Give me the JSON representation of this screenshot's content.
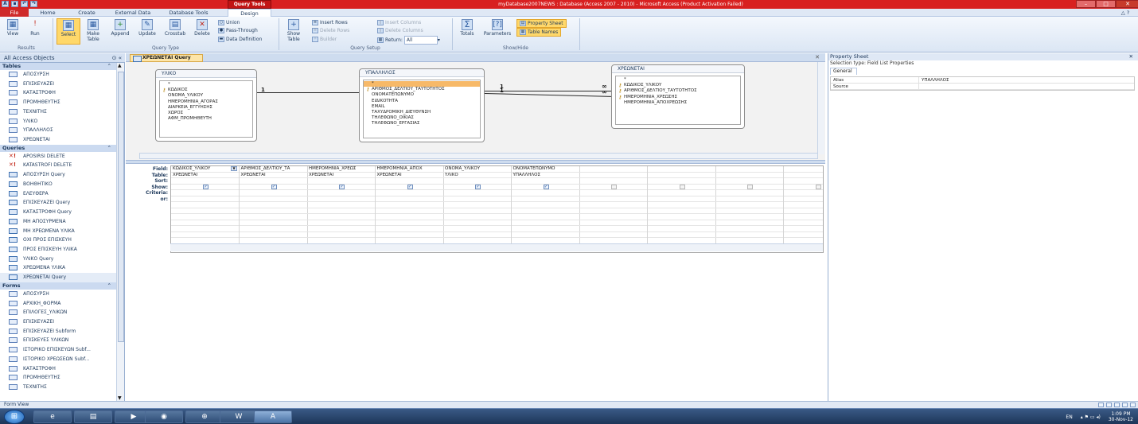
{
  "window": {
    "title": "myDatabase2007NEWS : Database (Access 2007 - 2010) - Microsoft Access (Product Activation Failed)",
    "context_tab": "Query Tools"
  },
  "ribbon_tabs": [
    "File",
    "Home",
    "Create",
    "External Data",
    "Database Tools",
    "Design"
  ],
  "ribbon": {
    "results": {
      "view": "View",
      "run": "Run",
      "group": "Results"
    },
    "query_type": {
      "select": "Select",
      "make_table": "Make Table",
      "append": "Append",
      "update": "Update",
      "crosstab": "Crosstab",
      "delete": "Delete",
      "union": "Union",
      "pass_through": "Pass-Through",
      "data_definition": "Data Definition",
      "group": "Query Type"
    },
    "query_setup": {
      "show_table": "Show Table",
      "insert_rows": "Insert Rows",
      "delete_rows": "Delete Rows",
      "builder": "Builder",
      "insert_columns": "Insert Columns",
      "delete_columns": "Delete Columns",
      "return_label": "Return:",
      "return_value": "All",
      "group": "Query Setup"
    },
    "show_hide": {
      "totals": "Totals",
      "parameters": "Parameters",
      "property_sheet": "Property Sheet",
      "table_names": "Table Names",
      "group": "Show/Hide"
    }
  },
  "nav": {
    "header": "All Access Objects",
    "sections": [
      {
        "title": "Tables",
        "type": "table",
        "items": [
          "ΑΠΟΣΥΡΣΗ",
          "ΕΠΙΣΚΕΥΑΖΕΙ",
          "ΚΑΤΑΣΤΡΟΦΗ",
          "ΠΡΟΜΗΘΕΥΤΗΣ",
          "ΤΕΧΝΙΤΗΣ",
          "ΥΛΙΚΟ",
          "ΥΠΑΛΛΗΛΟΣ",
          "ΧΡΕΩΝΕΤΑΙ"
        ]
      },
      {
        "title": "Queries",
        "type": "query",
        "items": [
          "APOSIRSI DELETE",
          "KATASTROFI DELETE",
          "ΑΠΟΣΥΡΣΗ Query",
          "ΒΟΗΘΗΤΙΚΟ",
          "ΕΛΕΥΘΕΡΑ",
          "ΕΠΙΣΚΕΥΑΖΕΙ Query",
          "ΚΑΤΑΣΤΡΟΦΗ Query",
          "ΜΗ ΑΠΟΣΥΡΜΕΝΑ",
          "ΜΗ ΧΡΕΩΜΕΝΑ ΥΛΙΚΑ",
          "ΟΧΙ ΠΡΟΣ ΕΠΙΣΚΕΥΗ",
          "ΠΡΟΣ ΕΠΙΣΚΕΥΗ ΥΛΙΚΑ",
          "ΥΛΙΚΟ Query",
          "ΧΡΕΩΜΕΝΑ ΥΛΙΚΑ",
          "ΧΡΕΩΝΕΤΑΙ Query"
        ]
      },
      {
        "title": "Forms",
        "type": "form",
        "items": [
          "ΑΠΟΣΥΡΣΗ",
          "ΑΡΧΙΚΗ_ΦΟΡΜΑ",
          "ΕΠΙΛΟΓΕΣ_ΥΛΙΚΩΝ",
          "ΕΠΙΣΚΕΥΑΖΕΙ",
          "ΕΠΙΣΚΕΥΑΖΕΙ Subform",
          "ΕΠΙΣΚΕΥΕΣ ΥΛΙΚΩΝ",
          "ΙΣΤΟΡΙΚΟ ΕΠΙΣΚΕΥΩΝ Subf...",
          "ΙΣΤΟΡΙΚΟ ΧΡΕΩΣΕΩΝ Subf...",
          "ΚΑΤΑΣΤΡΟΦΗ",
          "ΠΡΟΜΗΘΕΥΤΗΣ",
          "ΤΕΧΝΙΤΗΣ"
        ]
      }
    ]
  },
  "doc_tab": "ΧΡΕΩΝΕΤΑΙ Query",
  "tables": [
    {
      "name": "ΥΛΙΚΟ",
      "fields": [
        {
          "n": "*"
        },
        {
          "n": "ΚΩΔΙΚΟΣ",
          "pk": true
        },
        {
          "n": "ΟΝΟΜΑ_ΥΛΙΚΟΥ"
        },
        {
          "n": "ΗΜΕΡΟΜΗΝΙΑ_ΑΓΟΡΑΣ"
        },
        {
          "n": "ΔΙΑΡΚΕΙΑ_ΕΓΓΥΗΣΗΣ"
        },
        {
          "n": "ΧΩΡΟΣ"
        },
        {
          "n": "ΑΦΜ_ΠΡΟΜΗΘΕΥΤΗ"
        }
      ]
    },
    {
      "name": "ΥΠΑΛΛΗΛΟΣ",
      "fields": [
        {
          "n": "*",
          "hl": true
        },
        {
          "n": "ΑΡΙΘΜΟΣ_ΔΕΛΤΙΟΥ_ΤΑΥΤΟΤΗΤΟΣ",
          "pk": true
        },
        {
          "n": "ΟΝΟΜΑΤΕΠΩΝΥΜΟ"
        },
        {
          "n": "ΕΙΔΙΚΟΤΗΤΑ"
        },
        {
          "n": "EMAIL"
        },
        {
          "n": "ΤΑΧΥΔΡΟΜΙΚΗ_ΔΙΕΥΘΥΝΣΗ"
        },
        {
          "n": "ΤΗΛΕΦΩΝΟ_ΟΙΚΙΑΣ"
        },
        {
          "n": "ΤΗΛΕΦΩΝΟ_ΕΡΓΑΣΙΑΣ"
        }
      ]
    },
    {
      "name": "ΧΡΕΩΝΕΤΑΙ",
      "fields": [
        {
          "n": "*"
        },
        {
          "n": "ΚΩΔΙΚΟΣ_ΥΛΙΚΟΥ",
          "pk": true
        },
        {
          "n": "ΑΡΙΘΜΟΣ_ΔΕΛΤΙΟΥ_ΤΑΥΤΟΤΗΤΟΣ",
          "pk": true
        },
        {
          "n": "ΗΜΕΡΟΜΗΝΙΑ_ΧΡΕΩΣΗΣ",
          "pk": true
        },
        {
          "n": "ΗΜΕΡΟΜΗΝΙΑ_ΑΠΟΧΡΕΩΣΗΣ"
        }
      ]
    }
  ],
  "relationship_labels": {
    "one": "1",
    "many": "∞"
  },
  "grid": {
    "row_labels": [
      "Field:",
      "Table:",
      "Sort:",
      "Show:",
      "Criteria:",
      "or:"
    ],
    "columns": [
      {
        "field": "ΚΩΔΙΚΟΣ_ΥΛΙΚΟΥ",
        "table": "ΧΡΕΩΝΕΤΑΙ",
        "show": true
      },
      {
        "field": "ΑΡΙΘΜΟΣ_ΔΕΛΤΙΟΥ_ΤΑ",
        "table": "ΧΡΕΩΝΕΤΑΙ",
        "show": true
      },
      {
        "field": "ΗΜΕΡΟΜΗΝΙΑ_ΧΡΕΩΣ",
        "table": "ΧΡΕΩΝΕΤΑΙ",
        "show": true
      },
      {
        "field": "ΗΜΕΡΟΜΗΝΙΑ_ΑΠΟΧ",
        "table": "ΧΡΕΩΝΕΤΑΙ",
        "show": true
      },
      {
        "field": "ΟΝΟΜΑ_ΥΛΙΚΟΥ",
        "table": "ΥΛΙΚΟ",
        "show": true
      },
      {
        "field": "ΟΝΟΜΑΤΕΠΩΝΥΜΟ",
        "table": "ΥΠΑΛΛΗΛΟΣ",
        "show": true
      },
      {
        "field": "",
        "table": "",
        "show": false
      },
      {
        "field": "",
        "table": "",
        "show": false
      },
      {
        "field": "",
        "table": "",
        "show": false
      },
      {
        "field": "",
        "table": "",
        "show": false
      }
    ]
  },
  "property_sheet": {
    "title": "Property Sheet",
    "selection": "Selection type:  Field List Properties",
    "tab": "General",
    "rows": [
      {
        "k": "Alias",
        "v": "ΥΠΑΛΛΗΛΟΣ"
      },
      {
        "k": "Source",
        "v": ""
      }
    ]
  },
  "status": {
    "text": "Form View"
  },
  "taskbar": {
    "lang": "EN",
    "time": "1:09 PM",
    "date": "30-Nov-12"
  },
  "colors": {
    "title_bar": "#d82020",
    "selection": "#ffd86a"
  }
}
